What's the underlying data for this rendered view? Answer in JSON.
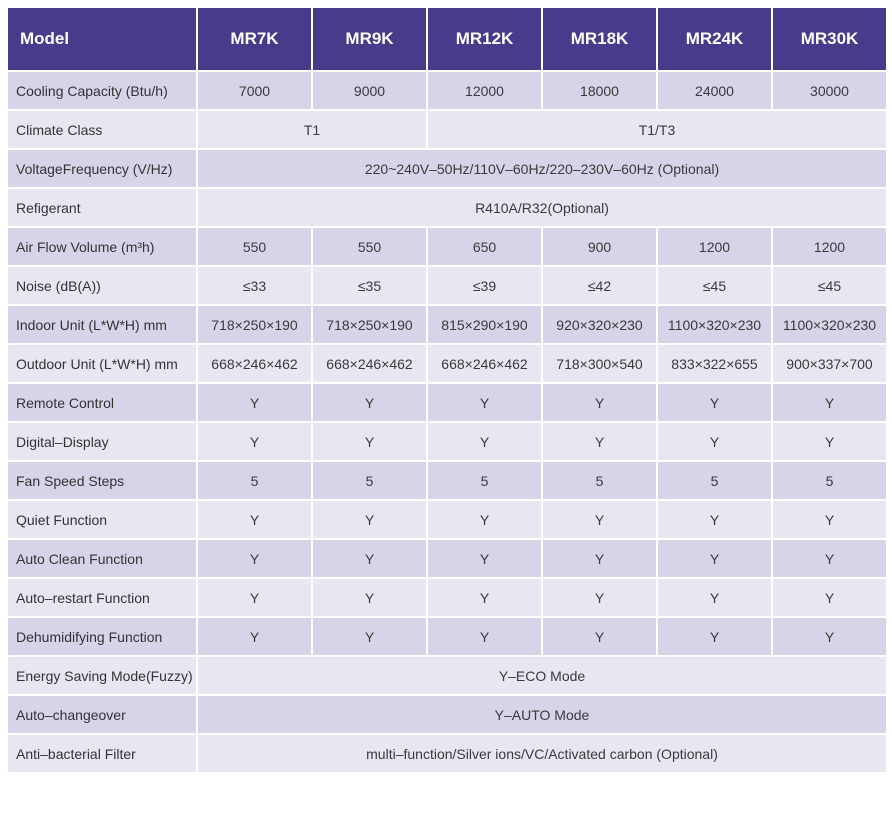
{
  "header": {
    "label": "Model",
    "models": [
      "MR7K",
      "MR9K",
      "MR12K",
      "MR18K",
      "MR24K",
      "MR30K"
    ]
  },
  "rows": {
    "cooling_capacity": {
      "label": "Cooling Capacity (Btu/h)",
      "values": [
        "7000",
        "9000",
        "12000",
        "18000",
        "24000",
        "30000"
      ]
    },
    "climate_class": {
      "label": "Climate Class",
      "group_a": "T1",
      "group_b": "T1/T3"
    },
    "voltage_frequency": {
      "label": "VoltageFrequency (V/Hz)",
      "value": "220~240V–50Hz/110V–60Hz/220–230V–60Hz (Optional)"
    },
    "refrigerant": {
      "label": "Refigerant",
      "value": "R410A/R32(Optional)"
    },
    "air_flow": {
      "label": "Air Flow Volume (m³h)",
      "values": [
        "550",
        "550",
        "650",
        "900",
        "1200",
        "1200"
      ]
    },
    "noise": {
      "label": "Noise (dB(A))",
      "values": [
        "≤33",
        "≤35",
        "≤39",
        "≤42",
        "≤45",
        "≤45"
      ]
    },
    "indoor_unit": {
      "label": "Indoor Unit (L*W*H) mm",
      "values": [
        "718×250×190",
        "718×250×190",
        "815×290×190",
        "920×320×230",
        "1100×320×230",
        "1100×320×230"
      ]
    },
    "outdoor_unit": {
      "label": "Outdoor Unit (L*W*H) mm",
      "values": [
        "668×246×462",
        "668×246×462",
        "668×246×462",
        "718×300×540",
        "833×322×655",
        "900×337×700"
      ]
    },
    "remote_control": {
      "label": "Remote Control",
      "values": [
        "Y",
        "Y",
        "Y",
        "Y",
        "Y",
        "Y"
      ]
    },
    "digital_display": {
      "label": "Digital–Display",
      "values": [
        "Y",
        "Y",
        "Y",
        "Y",
        "Y",
        "Y"
      ]
    },
    "fan_speed_steps": {
      "label": "Fan Speed Steps",
      "values": [
        "5",
        "5",
        "5",
        "5",
        "5",
        "5"
      ]
    },
    "quiet_function": {
      "label": "Quiet Function",
      "values": [
        "Y",
        "Y",
        "Y",
        "Y",
        "Y",
        "Y"
      ]
    },
    "auto_clean": {
      "label": "Auto Clean Function",
      "values": [
        "Y",
        "Y",
        "Y",
        "Y",
        "Y",
        "Y"
      ]
    },
    "auto_restart": {
      "label": "Auto–restart Function",
      "values": [
        "Y",
        "Y",
        "Y",
        "Y",
        "Y",
        "Y"
      ]
    },
    "dehumidifying": {
      "label": "Dehumidifying Function",
      "values": [
        "Y",
        "Y",
        "Y",
        "Y",
        "Y",
        "Y"
      ]
    },
    "energy_saving": {
      "label": "Energy Saving Mode(Fuzzy)",
      "value": "Y–ECO Mode"
    },
    "auto_changeover": {
      "label": "Auto–changeover",
      "value": "Y–AUTO Mode"
    },
    "anti_bacterial": {
      "label": "Anti–bacterial Filter",
      "value": "multi–function/Silver ions/VC/Activated carbon (Optional)"
    }
  },
  "colors": {
    "header_bg": "#4a3a8c",
    "row_light": "#e9e6f2",
    "row_dark": "#d8d3e8"
  }
}
